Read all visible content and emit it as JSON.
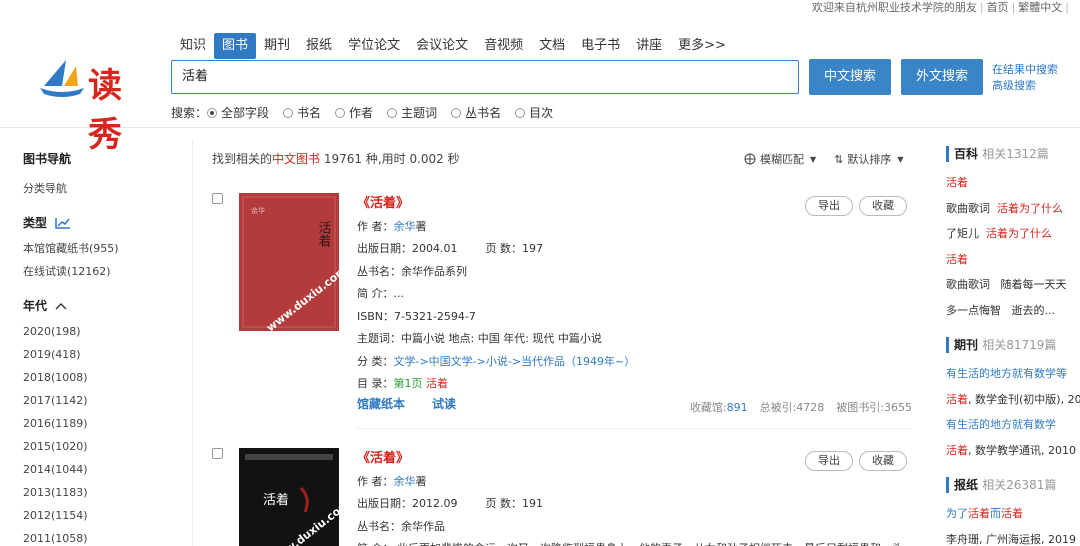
{
  "topbar": {
    "welcome": "欢迎来自杭州职业技术学院的朋友",
    "home": "首页",
    "traditional": "繁體中文"
  },
  "logo": {
    "text": "读秀"
  },
  "nav": {
    "tabs": [
      "知识",
      "图书",
      "期刊",
      "报纸",
      "学位论文",
      "会议论文",
      "音视频",
      "文档",
      "电子书",
      "讲座",
      "更多>>"
    ],
    "active_index": 1
  },
  "search": {
    "query": "活着",
    "btn_chinese": "中文搜索",
    "btn_foreign": "外文搜索",
    "in_results": "在结果中搜索",
    "advanced": "高级搜索",
    "prefix": "搜索：",
    "options": [
      "全部字段",
      "书名",
      "作者",
      "主题词",
      "丛书名",
      "目次"
    ],
    "selected_option": "全部字段"
  },
  "sidebar": {
    "nav_title": "图书导航",
    "nav_item": "分类导航",
    "type_title": "类型",
    "types": [
      "本馆馆藏纸书(955)",
      "在线试读(12162)"
    ],
    "year_title": "年代",
    "years": [
      "2020(198)",
      "2019(418)",
      "2018(1008)",
      "2017(1142)",
      "2016(1189)",
      "2015(1020)",
      "2014(1044)",
      "2013(1183)",
      "2012(1154)",
      "2011(1058)"
    ]
  },
  "results": {
    "prefix": "找到相关的",
    "category": "中文图书",
    "suffix": " 19761 种,用时 0.002 秒",
    "match_mode": "模糊匹配",
    "sort_mode": "默认排序"
  },
  "books": [
    {
      "title": "《活着》",
      "author_label": "作 者：",
      "author": "余华",
      "author_suffix": "著",
      "date": "出版日期：2004.01",
      "pages": "页 数：197",
      "series": "丛书名：余华作品系列",
      "summary": "简 介：...",
      "isbn": "ISBN：7-5321-2594-7",
      "subject": "主题词：中篇小说 地点: 中国 年代: 现代 中篇小说",
      "category_label": "分 类：",
      "category": "文学->中国文学->小说->当代作品（1949年~）",
      "toc_label": "目 录：",
      "toc_page": "第1页",
      "toc_hit": "活着",
      "export": "导出",
      "favorite": "收藏",
      "link_paper": "馆藏纸本",
      "link_try": "试读",
      "stat_holdings_label": "收藏馆:",
      "stat_holdings": "891",
      "stat_cited": "总被引:4728",
      "stat_book_cited": "被图书引:3655",
      "cover_watermark": "www.duxiu.com",
      "cover_title": "活着",
      "cover_author": "余华"
    },
    {
      "title": "《活着》",
      "author_label": "作 者：",
      "author": "余华",
      "author_suffix": "著",
      "date": "出版日期：2012.09",
      "pages": "页 数：191",
      "series": "丛书名：余华作品",
      "summary": "简 介：  此后更加悲惨的命运一次又一次降临到福贵身上，他的妻子、儿女和孙子相继死去，最后只剩福贵和一头",
      "export": "导出",
      "favorite": "收藏",
      "cover_watermark": "www.duxiu.com",
      "cover_title": "活着"
    }
  ],
  "right_panel": {
    "baike_title": "百科",
    "baike_count": "相关1312篇",
    "baike_lines": [
      {
        "plain": "",
        "hl": "活着"
      },
      {
        "plain": "歌曲歌词",
        "hl2": "活着为了什么"
      },
      {
        "plain": "了矩儿",
        "hl2": "活着为了什么"
      },
      {
        "plain": "",
        "hl": "活着"
      },
      {
        "plain": "歌曲歌词",
        "tail": "随着每一天天"
      },
      {
        "plain": "多一点悔智",
        "tail": "逝去的..."
      }
    ],
    "qikan_title": "期刊",
    "qikan_count": "相关81719篇",
    "qikan_lines": [
      {
        "blue": "有生活的地方就有数学等"
      },
      {
        "hl": "活着",
        "plain": ", 数学金刊(初中版), 201"
      },
      {
        "blue": "有生活的地方就有数学"
      },
      {
        "hl": "活着",
        "plain": ", 数学教学通讯, 2010"
      }
    ],
    "baozhi_title": "报纸",
    "baozhi_count": "相关26381篇",
    "baozhi_lines": [
      {
        "blue": "为了",
        "hl": "活着",
        "blue2": "而",
        "hl2": "活着"
      },
      {
        "plain": "李舟珊, 广州海运报, 2019"
      }
    ]
  },
  "colors": {
    "accent": "#2f79c5",
    "highlight": "#d6261d",
    "button": "#3a85c8"
  }
}
